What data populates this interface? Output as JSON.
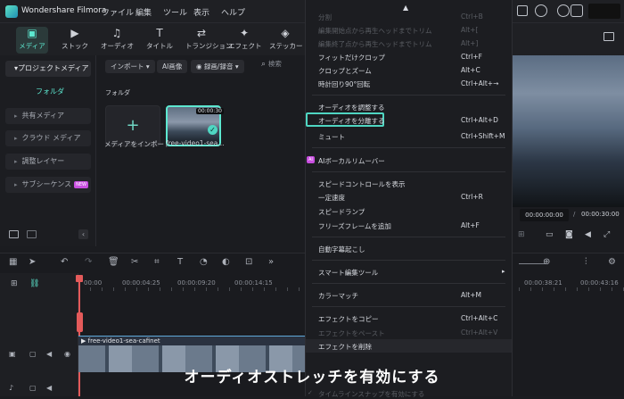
{
  "app": {
    "title": "Wondershare Filmora",
    "menu": [
      "ファイル",
      "編集",
      "ツール",
      "表示",
      "ヘルプ"
    ]
  },
  "toolbar": [
    {
      "label": "メディア",
      "icon": "media-icon",
      "active": true
    },
    {
      "label": "ストック",
      "icon": "stock-icon"
    },
    {
      "label": "オーディオ",
      "icon": "music-icon"
    },
    {
      "label": "タイトル",
      "icon": "title-icon"
    },
    {
      "label": "トランジション",
      "icon": "transition-icon"
    },
    {
      "label": "エフェクト",
      "icon": "effect-icon"
    },
    {
      "label": "ステッカー",
      "icon": "sticker-icon"
    }
  ],
  "left_panel": {
    "items": [
      {
        "label": "プロジェクトメディア",
        "selected": true
      },
      {
        "label": "フォルダ"
      },
      {
        "label": "共有メディア"
      },
      {
        "label": "クラウド メディア"
      },
      {
        "label": "調整レイヤー"
      },
      {
        "label": "サブシーケンス",
        "badge": "NEW"
      }
    ]
  },
  "media": {
    "import_label": "インポート",
    "ai_label": "AI画像",
    "record_label": "録画/録音",
    "search_placeholder": "検索",
    "folder_label": "フォルダ",
    "import_tile": "メディアをインポート",
    "clip_tile": "free-video1-sea...",
    "clip_duration": "00:00:30"
  },
  "preview": {
    "current_time": "00:00:00:00",
    "separator": "/",
    "total_time": "00:00:30:00"
  },
  "context_menu": {
    "items": [
      {
        "label": "分割",
        "shortcut": "Ctrl+B",
        "enabled": false
      },
      {
        "label": "編集開始点から再生ヘッドまでトリム",
        "shortcut": "Alt+[",
        "enabled": false
      },
      {
        "label": "編集終了点から再生ヘッドまでトリム",
        "shortcut": "Alt+]",
        "enabled": false
      },
      {
        "label": "フィットだけクロップ",
        "shortcut": "Ctrl+F",
        "enabled": true
      },
      {
        "label": "クロップとズーム",
        "shortcut": "Alt+C",
        "enabled": true
      },
      {
        "label": "時計回り90°回転",
        "shortcut": "Ctrl+Alt+→",
        "enabled": true
      },
      {
        "label": "オーディオを調整する",
        "shortcut": "",
        "enabled": true
      },
      {
        "label": "オーディオを分離する",
        "shortcut": "Ctrl+Alt+D",
        "enabled": true,
        "highlighted": true
      },
      {
        "label": "ミュート",
        "shortcut": "Ctrl+Shift+M",
        "enabled": true
      },
      {
        "label": "AIボーカルリムーバー",
        "shortcut": "",
        "enabled": true,
        "ai_badge": "AI"
      },
      {
        "label": "スピードコントロールを表示",
        "shortcut": "",
        "enabled": true
      },
      {
        "label": "一定速度",
        "shortcut": "Ctrl+R",
        "enabled": true
      },
      {
        "label": "スピードランプ",
        "shortcut": "",
        "enabled": true
      },
      {
        "label": "フリーズフレームを追加",
        "shortcut": "Alt+F",
        "enabled": true
      },
      {
        "label": "自動字幕起こし",
        "shortcut": "",
        "enabled": true
      },
      {
        "label": "スマート編集ツール",
        "shortcut": "",
        "enabled": true,
        "submenu": true
      },
      {
        "label": "カラーマッチ",
        "shortcut": "Alt+M",
        "enabled": true
      },
      {
        "label": "エフェクトをコピー",
        "shortcut": "Ctrl+Alt+C",
        "enabled": true
      },
      {
        "label": "エフェクトをペースト",
        "shortcut": "Ctrl+Alt+V",
        "enabled": false
      },
      {
        "label": "エフェクトを削除",
        "shortcut": "",
        "enabled": true
      },
      {
        "label": "タイムラインスナップを有効にする",
        "shortcut": "",
        "enabled": false,
        "checked": true
      }
    ]
  },
  "timeline": {
    "ruler": [
      "00:00",
      "00:00:04:25",
      "00:00:09:20",
      "00:00:14:15",
      "00:00:38:21",
      "00:00:43:16"
    ],
    "clip_label": "free-video1-sea-cafinet"
  },
  "subtitle": "オーディオストレッチを有効にする",
  "colors": {
    "accent": "#5de8d0",
    "background": "#1b1c20",
    "menu_highlight_border": "#4fd6c2"
  }
}
